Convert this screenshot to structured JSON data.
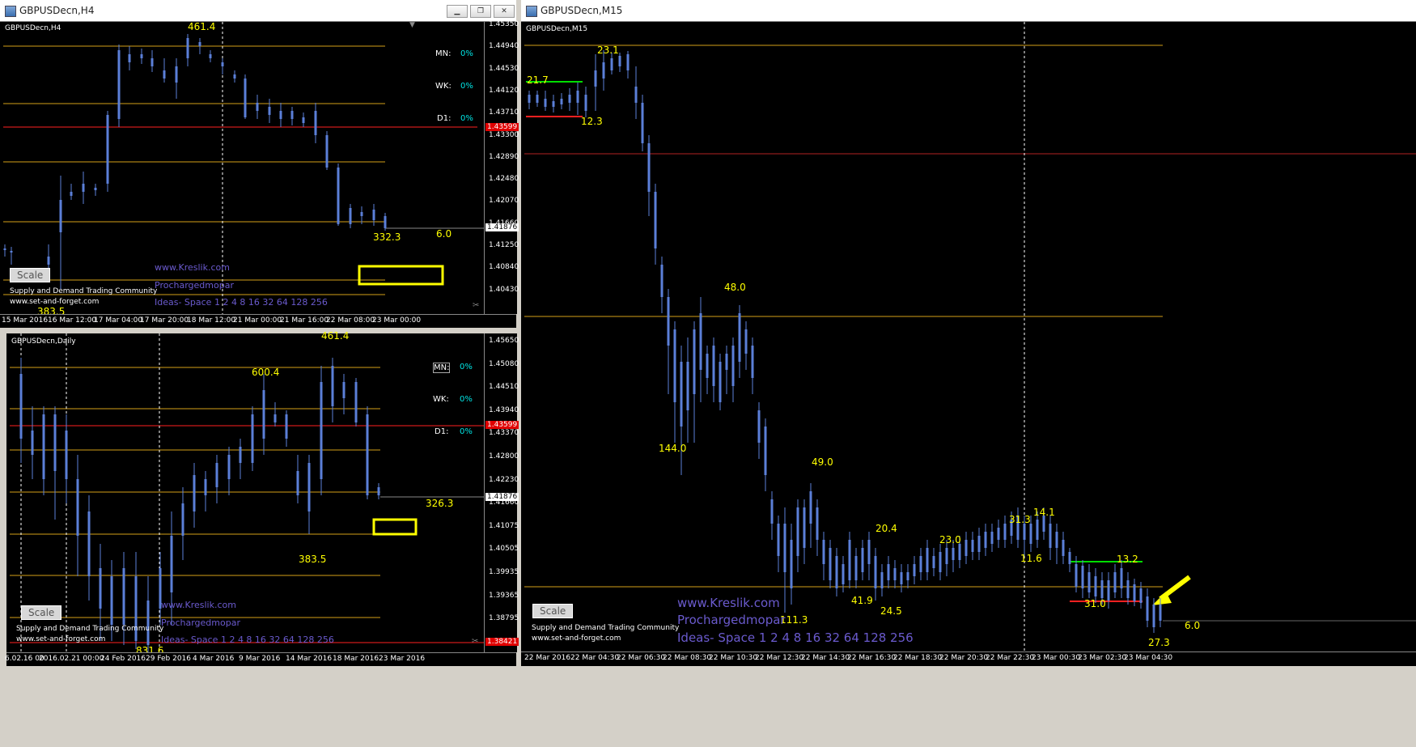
{
  "windows": {
    "h4": {
      "title": "GBPUSDecn,H4",
      "chart_name": "GBPUSDecn,H4",
      "price_axis": [
        "1.45350",
        "1.44940",
        "1.44530",
        "1.44120",
        "1.43710",
        "1.43300",
        "1.42890",
        "1.42480",
        "1.42070",
        "1.41660",
        "1.41250",
        "1.40840",
        "1.40430"
      ],
      "current_price": "1.41876",
      "red_price": "1.43599",
      "time_axis": [
        "15 Mar 2016",
        "16 Mar 12:00",
        "17 Mar 04:00",
        "17 Mar 20:00",
        "18 Mar 12:00",
        "21 Mar 00:00",
        "21 Mar 16:00",
        "22 Mar 08:00",
        "23 Mar 00:00"
      ],
      "annotations": [
        "461.4",
        "332.3",
        "6.0",
        "383.5"
      ],
      "pct": {
        "mn_label": "MN:",
        "mn": "0%",
        "wk_label": "WK:",
        "wk": "0%",
        "d1_label": "D1:",
        "d1": "0%"
      },
      "scale_label": "Scale",
      "watermark": {
        "site": "www.Kreslik.com",
        "name": "Prochargedmopar",
        "ideas": "Ideas- Space 1 2 4 8 16 32 64 128 256",
        "community": "Supply and Demand Trading Community",
        "url": "www.set-and-forget.com"
      }
    },
    "daily": {
      "chart_name": "GBPUSDecn,Daily",
      "price_axis": [
        "1.45650",
        "1.45080",
        "1.44510",
        "1.43940",
        "1.43370",
        "1.42800",
        "1.42230",
        "1.41660",
        "1.41075",
        "1.40505",
        "1.39935",
        "1.39365",
        "1.38795",
        "1.38225"
      ],
      "current_price": "1.41876",
      "red_price": "1.43599",
      "red_price2": "1.38421",
      "time_axis": [
        "6.02.16 00",
        "2016.02.21 00:00",
        "24 Feb 2016",
        "29 Feb 2016",
        "4 Mar 2016",
        "9 Mar 2016",
        "14 Mar 2016",
        "18 Mar 2016",
        "23 Mar 2016"
      ],
      "annotations": [
        "461.4",
        "600.4",
        "326.3",
        "383.5",
        "831.6"
      ],
      "pct": {
        "mn_label": "MN:",
        "mn": "0%",
        "wk_label": "WK:",
        "wk": "0%",
        "d1_label": "D1:",
        "d1": "0%"
      },
      "scale_label": "Scale",
      "watermark": {
        "site": "www.Kreslik.com",
        "name": "Prochargedmopar",
        "ideas": "Ideas- Space 1 2 4 8 16 32 64 128 256",
        "community": "Supply and Demand Trading Community",
        "url": "www.set-and-forget.com"
      }
    },
    "m15": {
      "title": "GBPUSDecn,M15",
      "chart_name": "GBPUSDecn,M15",
      "time_axis": [
        "22 Mar 2016",
        "22 Mar 04:30",
        "22 Mar 06:30",
        "22 Mar 08:30",
        "22 Mar 10:30",
        "22 Mar 12:30",
        "22 Mar 14:30",
        "22 Mar 16:30",
        "22 Mar 18:30",
        "22 Mar 20:30",
        "22 Mar 22:30",
        "23 Mar 00:30",
        "23 Mar 02:30",
        "23 Mar 04:30"
      ],
      "annotations": [
        "23.1",
        "21.7",
        "12.3",
        "48.0",
        "144.0",
        "49.0",
        "20.4",
        "23.0",
        "31.3",
        "14.1",
        "11.6",
        "13.2",
        "41.9",
        "24.5",
        "111.3",
        "31.0",
        "27.3",
        "6.0"
      ],
      "scale_label": "Scale",
      "watermark": {
        "site": "www.Kreslik.com",
        "name": "Prochargedmopar",
        "ideas": "Ideas- Space 1 2 4 8 16 32 64 128 256",
        "community": "Supply and Demand Trading Community",
        "url": "www.set-and-forget.com"
      }
    }
  },
  "colors": {
    "candle": "#5b7fd8",
    "level": "#d4a017",
    "red": "#ff2020",
    "green": "#00dd00",
    "highlight": "#ffff00",
    "pct": "#00e5e5"
  }
}
